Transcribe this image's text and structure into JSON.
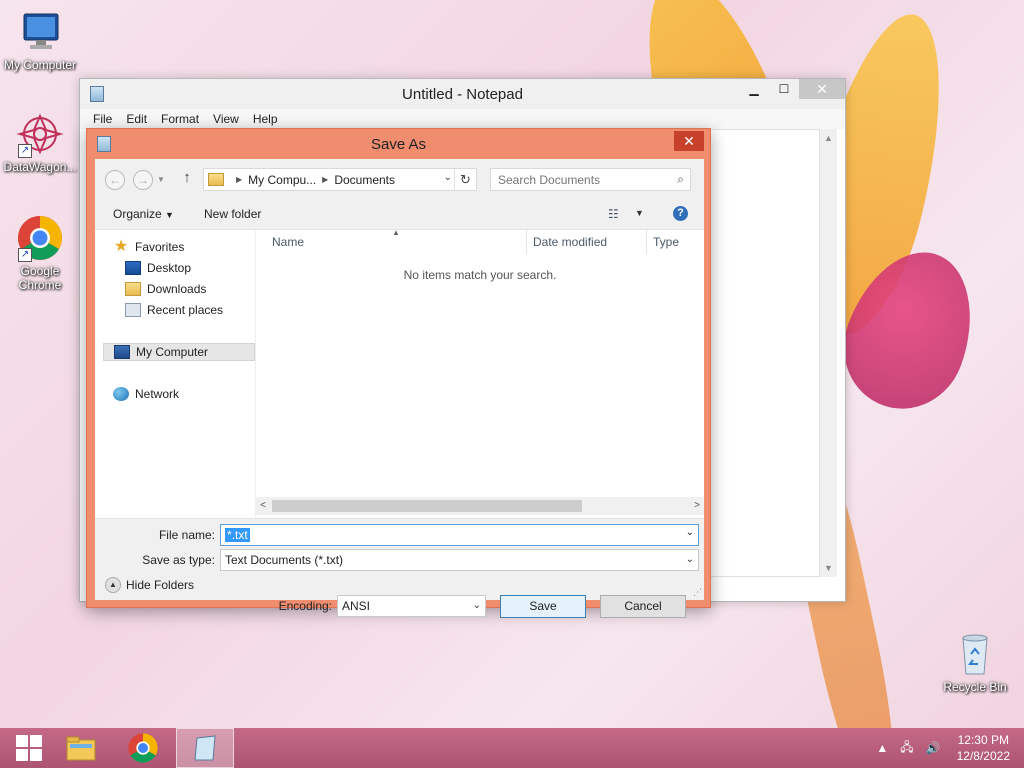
{
  "desktop": {
    "icons": [
      {
        "label": "My Computer"
      },
      {
        "label": "DataWagon..."
      },
      {
        "label": "Google Chrome"
      },
      {
        "label": "Recycle Bin"
      }
    ]
  },
  "notepad": {
    "title": "Untitled - Notepad",
    "menu": [
      "File",
      "Edit",
      "Format",
      "View",
      "Help"
    ]
  },
  "dialog": {
    "title": "Save As",
    "address": {
      "crumbs": [
        "My Compu...",
        "Documents"
      ]
    },
    "search_placeholder": "Search Documents",
    "toolbar": {
      "organize": "Organize",
      "new_folder": "New folder"
    },
    "nav": {
      "favorites": "Favorites",
      "desktop": "Desktop",
      "downloads": "Downloads",
      "recent": "Recent places",
      "my_computer": "My Computer",
      "network": "Network"
    },
    "columns": {
      "name": "Name",
      "date_modified": "Date modified",
      "type": "Type"
    },
    "empty_message": "No items match your search.",
    "file_name_label": "File name:",
    "file_name_value": "*.txt",
    "save_type_label": "Save as type:",
    "save_type_value": "Text Documents (*.txt)",
    "encoding_label": "Encoding:",
    "encoding_value": "ANSI",
    "hide_folders": "Hide Folders",
    "save_label": "Save",
    "cancel_label": "Cancel"
  },
  "taskbar": {
    "time": "12:30 PM",
    "date": "12/8/2022"
  },
  "colors": {
    "dialog_frame": "#f08d6e",
    "taskbar": "#b35a78",
    "selection": "#3399ff"
  }
}
